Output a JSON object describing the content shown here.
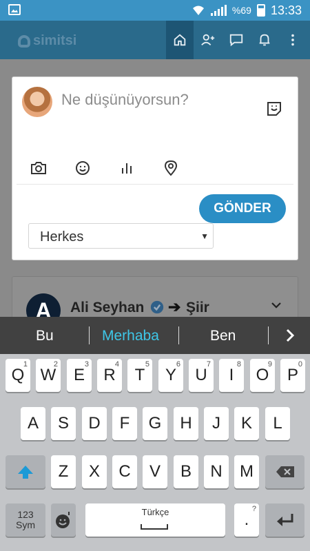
{
  "status_bar": {
    "battery": "%69",
    "time": "13:33"
  },
  "app": {
    "logo": "simitsi"
  },
  "composer": {
    "placeholder": "Ne düşünüyorsun?",
    "send_label": "GÖNDER",
    "audience": "Herkes"
  },
  "post": {
    "avatar_letter": "A",
    "author": "Ali Seyhan",
    "target": "Şiir"
  },
  "keyboard": {
    "suggestions": [
      "Bu",
      "Merhaba",
      "Ben"
    ],
    "row1": [
      "Q",
      "W",
      "E",
      "R",
      "T",
      "Y",
      "U",
      "I",
      "O",
      "P"
    ],
    "row1_nums": [
      "1",
      "2",
      "3",
      "4",
      "5",
      "6",
      "7",
      "8",
      "9",
      "0"
    ],
    "row2": [
      "A",
      "S",
      "D",
      "F",
      "G",
      "H",
      "J",
      "K",
      "L"
    ],
    "row3": [
      "Z",
      "X",
      "C",
      "V",
      "B",
      "N",
      "M"
    ],
    "sym_label_1": "123",
    "sym_label_2": "Sym",
    "space_label": "Türkçe",
    "period": "."
  }
}
